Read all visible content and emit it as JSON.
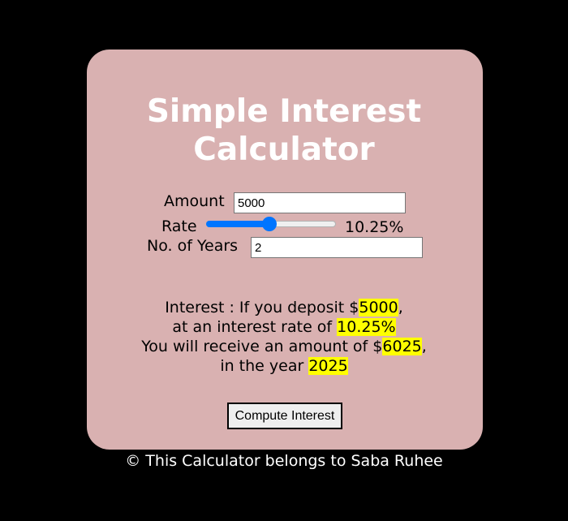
{
  "title": {
    "line1": "Simple Interest",
    "line2": "Calculator"
  },
  "form": {
    "amount_label": "Amount",
    "amount_value": "5000",
    "rate_label": "Rate",
    "rate_fraction": 0.49,
    "rate_display": "10.25%",
    "years_label": "No. of Years",
    "years_value": "2"
  },
  "result": {
    "prefix1": "Interest : If you deposit $",
    "amount": "5000",
    "suffix1": ",",
    "prefix2": "at an interest rate of ",
    "rate": "10.25%",
    "prefix3": "You will receive an amount of $",
    "total": "6025",
    "suffix3": ",",
    "prefix4": "in the year ",
    "year": "2025"
  },
  "button": {
    "label": "Compute Interest"
  },
  "footer": {
    "text": "© This Calculator belongs to Saba Ruhee"
  },
  "colors": {
    "background": "#000000",
    "card": "#d9b1b1",
    "highlight": "#ffff00",
    "slider_accent": "#0075ff"
  }
}
